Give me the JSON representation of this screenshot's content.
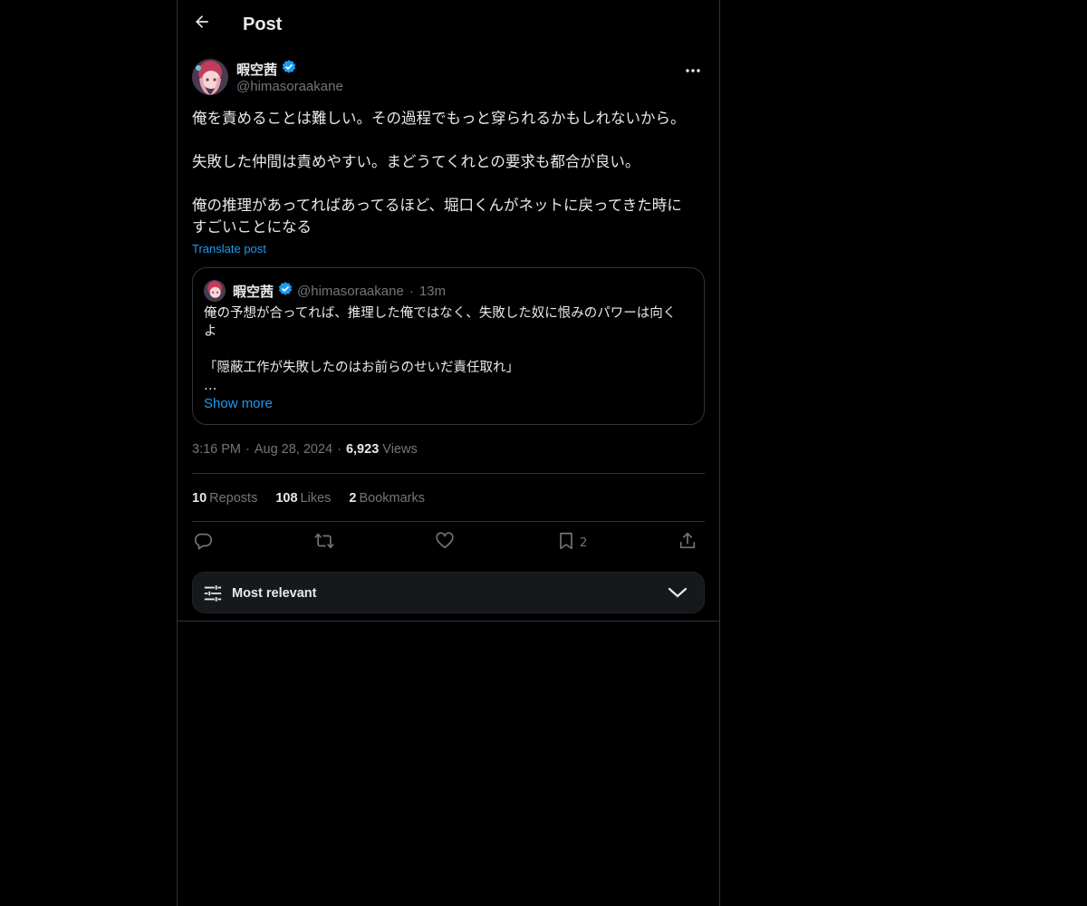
{
  "header": {
    "title": "Post"
  },
  "post": {
    "author_name": "暇空茜",
    "author_handle": "@himasoraakane",
    "text": "俺を責めることは難しい。その過程でもっと穿られるかもしれないから。\n\n失敗した仲間は責めやすい。まどうてくれとの要求も都合が良い。\n\n俺の推理があってればあってるほど、堀口くんがネットに戻ってきた時に\nすごいことになる",
    "translate_label": "Translate post",
    "time": "3:16 PM",
    "date": "Aug 28, 2024",
    "views_count": "6,923",
    "views_label": "Views",
    "dot": "·"
  },
  "quote": {
    "author_name": "暇空茜",
    "author_handle": "@himasoraakane",
    "dot": "·",
    "time": "13m",
    "text": "俺の予想が合ってれば、推理した俺ではなく、失敗した奴に恨みのパワーは向く\nよ\n\n「隠蔽工作が失敗したのはお前らのせいだ責任取れ」\n…",
    "show_more": "Show more"
  },
  "stats": {
    "reposts_count": "10",
    "reposts_label": "Reposts",
    "likes_count": "108",
    "likes_label": "Likes",
    "bookmarks_count": "2",
    "bookmarks_label": "Bookmarks"
  },
  "actions": {
    "bookmark_count": "2"
  },
  "sort": {
    "label": "Most relevant"
  },
  "colors": {
    "accent": "#1d9bf0",
    "background": "#000000",
    "muted": "#71767b",
    "border": "#2f3336"
  },
  "icons": [
    "back-arrow-icon",
    "verified-badge-icon",
    "more-icon",
    "reply-icon",
    "repost-icon",
    "like-icon",
    "bookmark-icon",
    "share-icon",
    "sliders-icon",
    "chevron-down-icon"
  ]
}
